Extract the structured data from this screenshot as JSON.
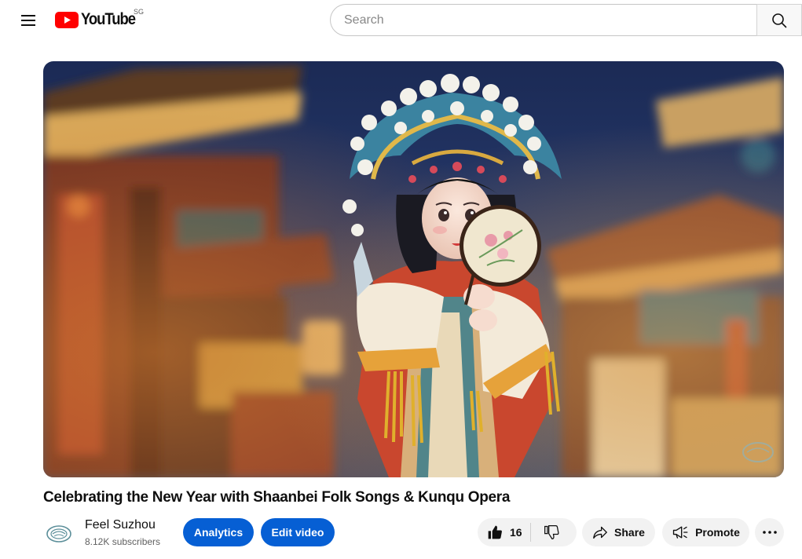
{
  "header": {
    "logo_text": "YouTube",
    "country_code": "SG",
    "search_placeholder": "Search"
  },
  "video": {
    "title": "Celebrating the New Year with Shaanbei Folk Songs & Kunqu Opera"
  },
  "channel": {
    "name": "Feel Suzhou",
    "subscribers": "8.12K subscribers"
  },
  "actions": {
    "analytics_label": "Analytics",
    "edit_label": "Edit video",
    "like_count": "16",
    "share_label": "Share",
    "promote_label": "Promote"
  },
  "icons": [
    "menu-icon",
    "youtube-logo-icon",
    "search-icon",
    "channel-logo-icon",
    "thumbs-up-icon",
    "thumbs-down-icon",
    "share-icon",
    "promote-icon",
    "more-icon"
  ],
  "colors": {
    "youtube_red": "#ff0000",
    "primary_blue": "#065fd4",
    "pill_grey": "#f2f2f2"
  }
}
